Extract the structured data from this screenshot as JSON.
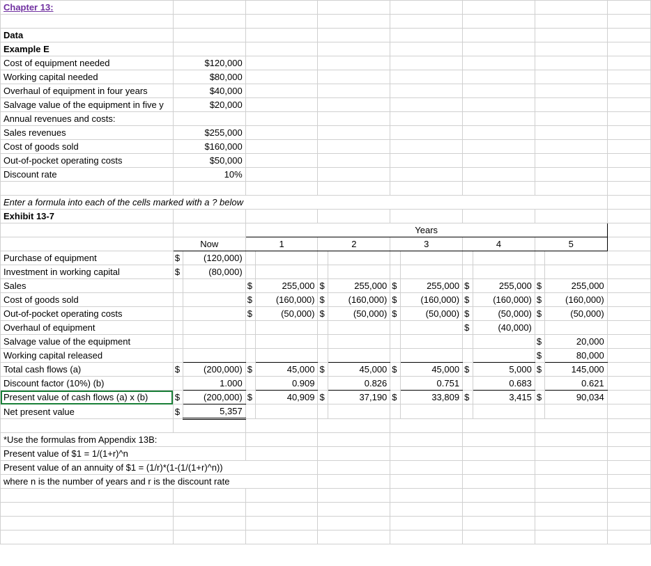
{
  "header": {
    "chapter": "Chapter 13:"
  },
  "section": {
    "data": "Data",
    "example": "Example E",
    "instruction": "Enter a formula into each of the cells marked with a ? below",
    "exhibit": "Exhibit 13-7"
  },
  "years_header": "Years",
  "cols": {
    "now": "Now",
    "y1": "1",
    "y2": "2",
    "y3": "3",
    "y4": "4",
    "y5": "5"
  },
  "data_rows": {
    "cost_eq_label": "Cost of equipment needed",
    "cost_eq_val": "$120,000",
    "wc_label": "Working capital needed",
    "wc_val": "$80,000",
    "overhaul_label": "Overhaul of equipment in four years",
    "overhaul_val": "$40,000",
    "salvage_label": "Salvage value of the equipment in five y",
    "salvage_val": "$20,000",
    "annual_label": "Annual revenues and costs:",
    "sales_label": "Sales revenues",
    "sales_val": "$255,000",
    "cogs_label": "Cost of goods sold",
    "cogs_val": "$160,000",
    "oop_label": "Out-of-pocket operating costs",
    "oop_val": "$50,000",
    "disc_label": "Discount rate",
    "disc_val": "10%"
  },
  "exhibit_rows": {
    "purchase": {
      "label": "Purchase of equipment",
      "now_s": "$",
      "now_v": "(120,000)"
    },
    "invwc": {
      "label": "Investment in working capital",
      "now_s": "$",
      "now_v": "(80,000)"
    },
    "sales": {
      "label": "Sales",
      "s": "$",
      "v": "255,000"
    },
    "cogs": {
      "label": "Cost of goods sold",
      "s": "$",
      "v": "(160,000)"
    },
    "oop": {
      "label": "Out-of-pocket operating costs",
      "s": "$",
      "v": "(50,000)"
    },
    "overhaul": {
      "label": "Overhaul of equipment",
      "s": "$",
      "v": "(40,000)"
    },
    "salvage": {
      "label": "Salvage value of the equipment",
      "s": "$",
      "v": "20,000"
    },
    "wcrel": {
      "label": "Working capital released",
      "s": "$",
      "v": "80,000"
    },
    "total": {
      "label": "Total cash flows (a)",
      "s": "$",
      "now": "(200,000)",
      "y1": "45,000",
      "y2": "45,000",
      "y3": "45,000",
      "y4": "5,000",
      "y5": "145,000"
    },
    "df": {
      "label": "Discount factor (10%) (b)",
      "now": "1.000",
      "y1": "0.909",
      "y2": "0.826",
      "y3": "0.751",
      "y4": "0.683",
      "y5": "0.621"
    },
    "pv": {
      "label": "Present value of cash flows (a) x (b)",
      "s": "$",
      "now": "(200,000)",
      "y1": "40,909",
      "y2": "37,190",
      "y3": "33,809",
      "y4": "3,415",
      "y5": "90,034"
    },
    "npv": {
      "label": "Net present value",
      "s": "$",
      "v": "5,357"
    }
  },
  "footer": {
    "l1": "*Use the formulas from Appendix 13B:",
    "l2": "Present value of $1 = 1/(1+r)^n",
    "l3": "Present value of an annuity of $1 = (1/r)*(1-(1/(1+r)^n))",
    "l4": "where n is the number of years and r is the discount rate"
  },
  "chart_data": {
    "type": "table",
    "title": "Net Present Value Analysis (Exhibit 13-7)",
    "inputs": {
      "cost_of_equipment": 120000,
      "working_capital": 80000,
      "overhaul_year4": 40000,
      "salvage_year5": 20000,
      "sales_revenue": 255000,
      "cogs": 160000,
      "out_of_pocket": 50000,
      "discount_rate": 0.1
    },
    "years": [
      "Now",
      1,
      2,
      3,
      4,
      5
    ],
    "cash_flows": {
      "purchase_of_equipment": [
        -120000,
        null,
        null,
        null,
        null,
        null
      ],
      "investment_working_cap": [
        -80000,
        null,
        null,
        null,
        null,
        null
      ],
      "sales": [
        null,
        255000,
        255000,
        255000,
        255000,
        255000
      ],
      "cost_of_goods_sold": [
        null,
        -160000,
        -160000,
        -160000,
        -160000,
        -160000
      ],
      "out_of_pocket": [
        null,
        -50000,
        -50000,
        -50000,
        -50000,
        -50000
      ],
      "overhaul": [
        null,
        null,
        null,
        null,
        -40000,
        null
      ],
      "salvage": [
        null,
        null,
        null,
        null,
        null,
        20000
      ],
      "working_cap_released": [
        null,
        null,
        null,
        null,
        null,
        80000
      ],
      "total": [
        -200000,
        45000,
        45000,
        45000,
        5000,
        145000
      ],
      "discount_factor": [
        1.0,
        0.909,
        0.826,
        0.751,
        0.683,
        0.621
      ],
      "present_value": [
        -200000,
        40909,
        37190,
        33809,
        3415,
        90034
      ]
    },
    "net_present_value": 5357
  }
}
